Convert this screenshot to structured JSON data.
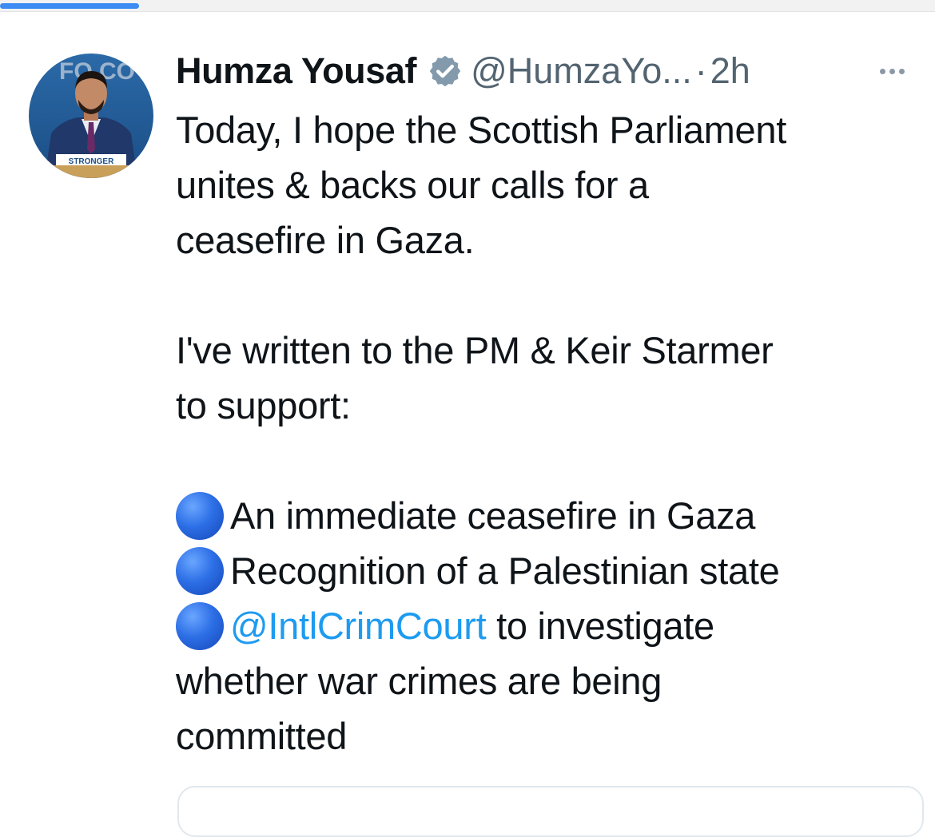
{
  "colors": {
    "accent": "#1d9bf0",
    "text": "#0f1419",
    "secondary": "#536471",
    "verified_badge": "#829aab",
    "bullet": "#2d6fe6"
  },
  "tweet": {
    "author": {
      "display_name": "Humza Yousaf",
      "handle": "@HumzaYo...",
      "verified_icon": "verified-badge-icon"
    },
    "separator": "·",
    "time": "2h",
    "more_icon": "more-horizontal-icon",
    "avatar": {
      "sign_text": "STRONGER",
      "backdrop_text": "FO COT"
    },
    "body": {
      "lines": [
        "Today, I hope the Scottish Parliament",
        "unites & backs our calls for a",
        "ceasefire in Gaza."
      ],
      "lines2": [
        "I've written to the PM & Keir Starmer",
        "to support:"
      ],
      "bullet_icon": "blue-circle-icon",
      "bullets": [
        "An immediate ceasefire in Gaza",
        "Recognition of a Palestinian state"
      ],
      "mention": "@IntlCrimCourt",
      "mention_tail": " to investigate",
      "tail_lines": [
        "whether war crimes are being",
        "committed"
      ]
    }
  }
}
